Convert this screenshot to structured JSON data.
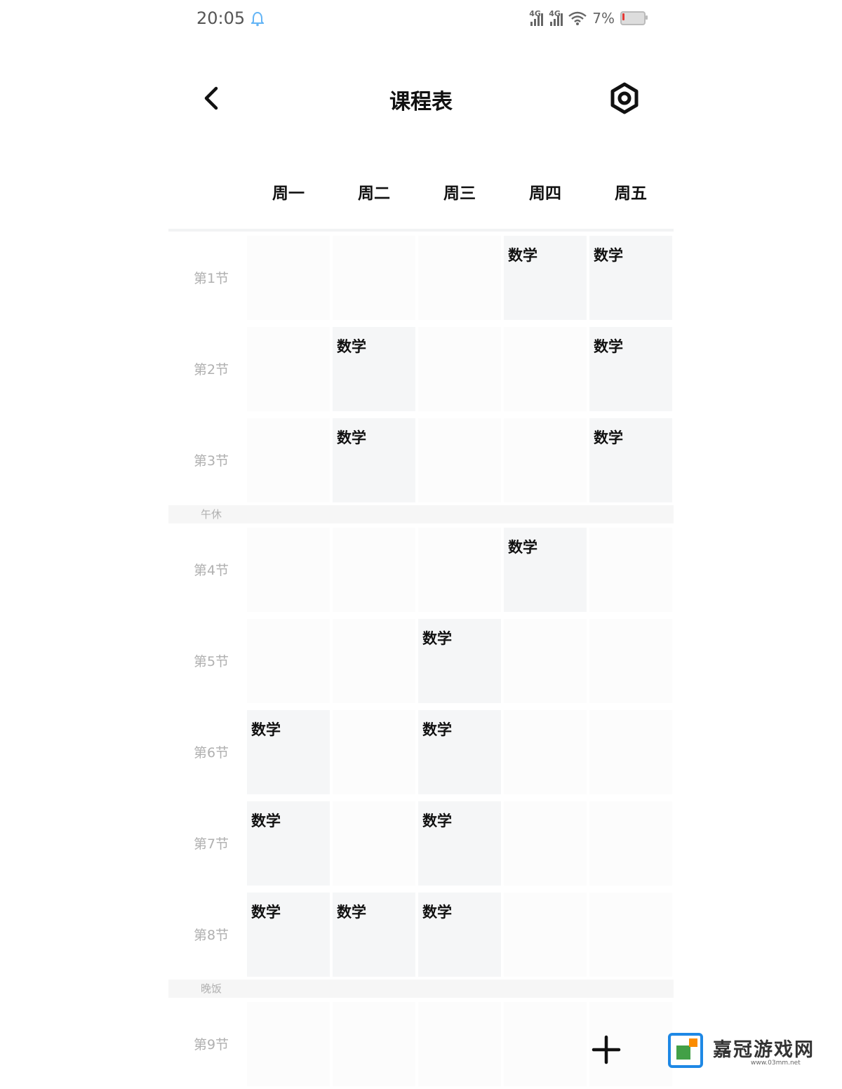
{
  "status_bar": {
    "time": "20:05",
    "net1": "4G",
    "net2": "4G",
    "battery": "7%"
  },
  "header": {
    "title": "课程表"
  },
  "days": [
    "周一",
    "周二",
    "周三",
    "周四",
    "周五"
  ],
  "breaks": {
    "lunch": "午休",
    "dinner": "晚饭"
  },
  "schedule": [
    {
      "label": "第1节",
      "cells": [
        "",
        "",
        "",
        "数学",
        "数学"
      ]
    },
    {
      "label": "第2节",
      "cells": [
        "",
        "数学",
        "",
        "",
        "数学"
      ]
    },
    {
      "label": "第3节",
      "cells": [
        "",
        "数学",
        "",
        "",
        "数学"
      ]
    },
    {
      "label": "第4节",
      "cells": [
        "",
        "",
        "",
        "数学",
        ""
      ]
    },
    {
      "label": "第5节",
      "cells": [
        "",
        "",
        "数学",
        "",
        ""
      ]
    },
    {
      "label": "第6节",
      "cells": [
        "数学",
        "",
        "数学",
        "",
        ""
      ]
    },
    {
      "label": "第7节",
      "cells": [
        "数学",
        "",
        "数学",
        "",
        ""
      ]
    },
    {
      "label": "第8节",
      "cells": [
        "数学",
        "数学",
        "数学",
        "",
        ""
      ]
    },
    {
      "label": "第9节",
      "cells": [
        "",
        "",
        "",
        "",
        ""
      ]
    }
  ],
  "watermark": {
    "name": "嘉冠游戏网",
    "url": "www.03mm.net"
  },
  "icons": {
    "back": "chevron-left-icon",
    "settings": "gear-icon",
    "add": "plus-icon",
    "bell": "bell-icon"
  }
}
